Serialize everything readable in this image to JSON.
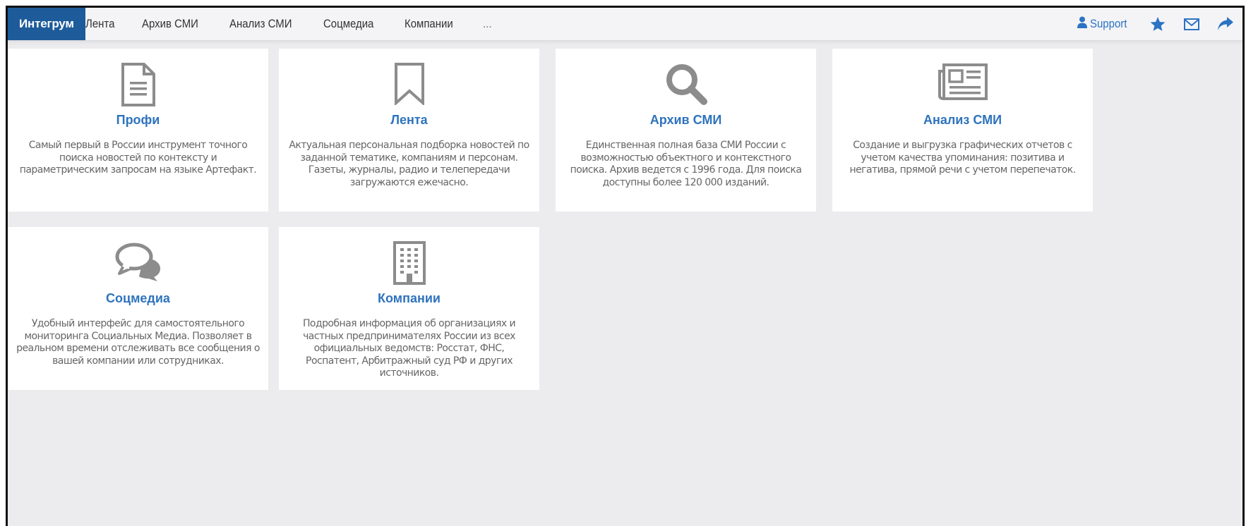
{
  "header": {
    "brand": "Интегрум",
    "nav": [
      "Лента",
      "Архив СМИ",
      "Анализ СМИ",
      "Соцмедиа",
      "Компании",
      "..."
    ],
    "support_label": "Support",
    "icons": [
      "user-icon",
      "star-icon",
      "mail-icon",
      "share-icon"
    ]
  },
  "cards": [
    {
      "icon": "document-icon",
      "title": "Профи",
      "desc": "Самый первый в России инструмент точного поиска новостей по контексту и параметрическим запросам на языке Артефакт."
    },
    {
      "icon": "bookmark-icon",
      "title": "Лента",
      "desc": "Актуальная персональная подборка новостей по заданной тематике, компаниям и персонам. Газеты, журналы, радио и телепередачи загружаются ежечасно."
    },
    {
      "icon": "search-icon",
      "title": "Архив СМИ",
      "desc": "Единственная полная база СМИ России с возможностью объектного и контекстного поиска. Архив ведется с 1996 года. Для поиска доступны более 120 000 изданий."
    },
    {
      "icon": "newspaper-icon",
      "title": "Анализ СМИ",
      "desc": "Создание и выгрузка графических отчетов с учетом качества упоминания: позитива и негатива, прямой речи с учетом перепечаток."
    },
    {
      "icon": "comments-icon",
      "title": "Соцмедиа",
      "desc": "Удобный интерфейс для самостоятельного мониторинга Социальных Медиа. Позволяет в реальном времени отслеживать все сообщения о вашей компании или сотрудниках."
    },
    {
      "icon": "building-icon",
      "title": "Компании",
      "desc": "Подробная информация об организациях и частных предпринимателях России из всех официальных ведомств: Росстат, ФНС, Роспатент, Арбитражный суд РФ и других источников."
    }
  ],
  "colors": {
    "brand_bg": "#1e5b9a",
    "link": "#2e73bd",
    "icon_gray": "#8c8c8c",
    "page_bg": "#ececee"
  }
}
